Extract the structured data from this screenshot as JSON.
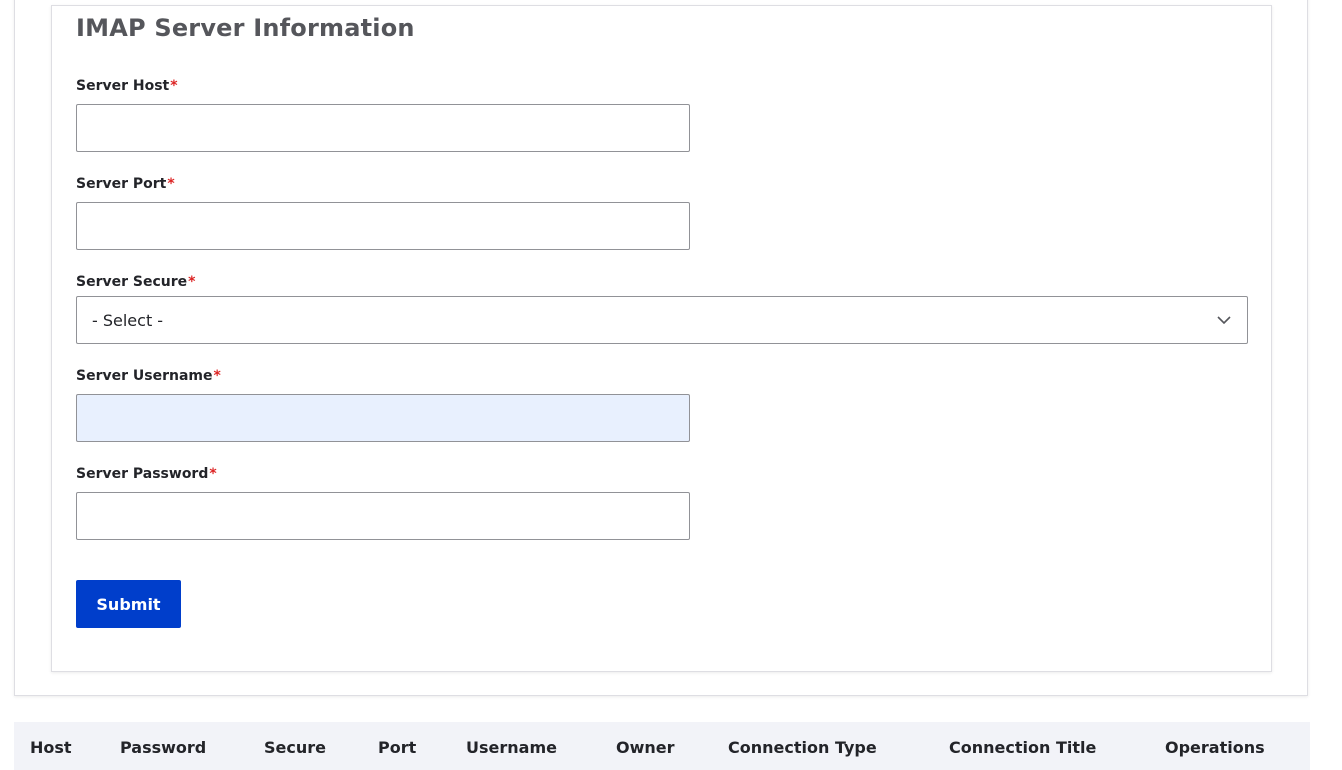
{
  "form": {
    "title": "IMAP Server Information",
    "required_marker": "*",
    "fields": {
      "host": {
        "label": "Server Host",
        "value": "",
        "placeholder": ""
      },
      "port": {
        "label": "Server Port",
        "value": "",
        "placeholder": ""
      },
      "secure": {
        "label": "Server Secure",
        "selected": "- Select -"
      },
      "username": {
        "label": "Server Username",
        "value": "",
        "placeholder": ""
      },
      "password": {
        "label": "Server Password",
        "value": "",
        "placeholder": ""
      }
    },
    "submit_label": "Submit"
  },
  "table": {
    "columns": [
      "Host",
      "Password",
      "Secure",
      "Port",
      "Username",
      "Owner",
      "Connection Type",
      "Connection Title",
      "Operations"
    ],
    "rows": []
  },
  "colors": {
    "primary": "#003ecb",
    "required": "#dc2323",
    "autofill": "#e8f0fe",
    "table_header_bg": "#f2f3f8"
  }
}
